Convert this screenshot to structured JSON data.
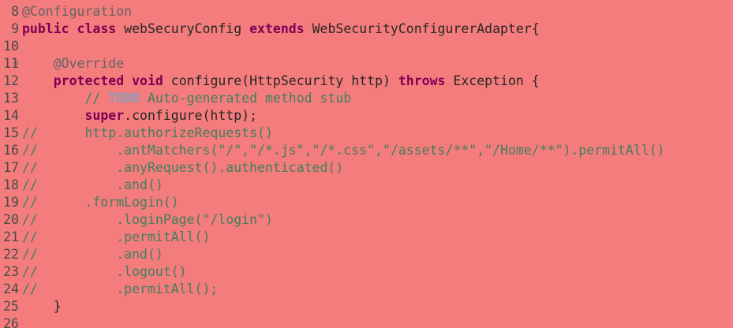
{
  "editor": {
    "lines": [
      {
        "num": "8",
        "segments": [
          {
            "t": "@Configuration",
            "c": "ann"
          }
        ]
      },
      {
        "num": "9",
        "segments": [
          {
            "t": "public",
            "c": "kw"
          },
          {
            "t": " "
          },
          {
            "t": "class",
            "c": "kw"
          },
          {
            "t": " webSecuryConfig "
          },
          {
            "t": "extends",
            "c": "kw"
          },
          {
            "t": " WebSecurityConfigurerAdapter{"
          }
        ]
      },
      {
        "num": "10",
        "segments": []
      },
      {
        "num": "11",
        "fold": "⊖",
        "segments": [
          {
            "t": "    "
          },
          {
            "t": "@Override",
            "c": "ann"
          }
        ]
      },
      {
        "num": "12",
        "segments": [
          {
            "t": "    "
          },
          {
            "t": "protected",
            "c": "kw"
          },
          {
            "t": " "
          },
          {
            "t": "void",
            "c": "kw"
          },
          {
            "t": " configure(HttpSecurity http) "
          },
          {
            "t": "throws",
            "c": "kw"
          },
          {
            "t": " Exception {"
          }
        ]
      },
      {
        "num": "13",
        "segments": [
          {
            "t": "        "
          },
          {
            "t": "// ",
            "c": "cm"
          },
          {
            "t": "TODO",
            "c": "todo"
          },
          {
            "t": " Auto-generated method stub",
            "c": "cm"
          }
        ]
      },
      {
        "num": "14",
        "segments": [
          {
            "t": "        "
          },
          {
            "t": "super",
            "c": "kw"
          },
          {
            "t": ".configure(http);"
          }
        ]
      },
      {
        "num": "15",
        "segments": [
          {
            "t": "//",
            "c": "cm"
          },
          {
            "t": "      http.authorizeRequests()",
            "c": "cm"
          }
        ]
      },
      {
        "num": "16",
        "segments": [
          {
            "t": "//",
            "c": "cm"
          },
          {
            "t": "          .antMatchers(\"/\",\"/*.js\",\"/*.css\",\"/assets/**\",\"/Home/**\").permitAll()",
            "c": "cm"
          }
        ]
      },
      {
        "num": "17",
        "segments": [
          {
            "t": "//",
            "c": "cm"
          },
          {
            "t": "          .anyRequest().authenticated()",
            "c": "cm"
          }
        ]
      },
      {
        "num": "18",
        "segments": [
          {
            "t": "//",
            "c": "cm"
          },
          {
            "t": "          .and()",
            "c": "cm"
          }
        ]
      },
      {
        "num": "19",
        "segments": [
          {
            "t": "//",
            "c": "cm"
          },
          {
            "t": "      .formLogin()",
            "c": "cm"
          }
        ]
      },
      {
        "num": "20",
        "segments": [
          {
            "t": "//",
            "c": "cm"
          },
          {
            "t": "          .loginPage(\"/login\")",
            "c": "cm"
          }
        ]
      },
      {
        "num": "21",
        "segments": [
          {
            "t": "//",
            "c": "cm"
          },
          {
            "t": "          .permitAll()",
            "c": "cm"
          }
        ]
      },
      {
        "num": "22",
        "segments": [
          {
            "t": "//",
            "c": "cm"
          },
          {
            "t": "          .and()",
            "c": "cm"
          }
        ]
      },
      {
        "num": "23",
        "segments": [
          {
            "t": "//",
            "c": "cm"
          },
          {
            "t": "          .logout()",
            "c": "cm"
          }
        ]
      },
      {
        "num": "24",
        "segments": [
          {
            "t": "//",
            "c": "cm"
          },
          {
            "t": "          .permitAll();",
            "c": "cm"
          }
        ]
      },
      {
        "num": "25",
        "segments": [
          {
            "t": "    }"
          }
        ]
      },
      {
        "num": "26",
        "segments": []
      }
    ]
  },
  "colors": {
    "background": "#f47c7c",
    "keyword": "#7f0055",
    "comment": "#3f7f5f",
    "annotation": "#646464",
    "text": "#262626",
    "line_number": "#4a4a4a"
  }
}
